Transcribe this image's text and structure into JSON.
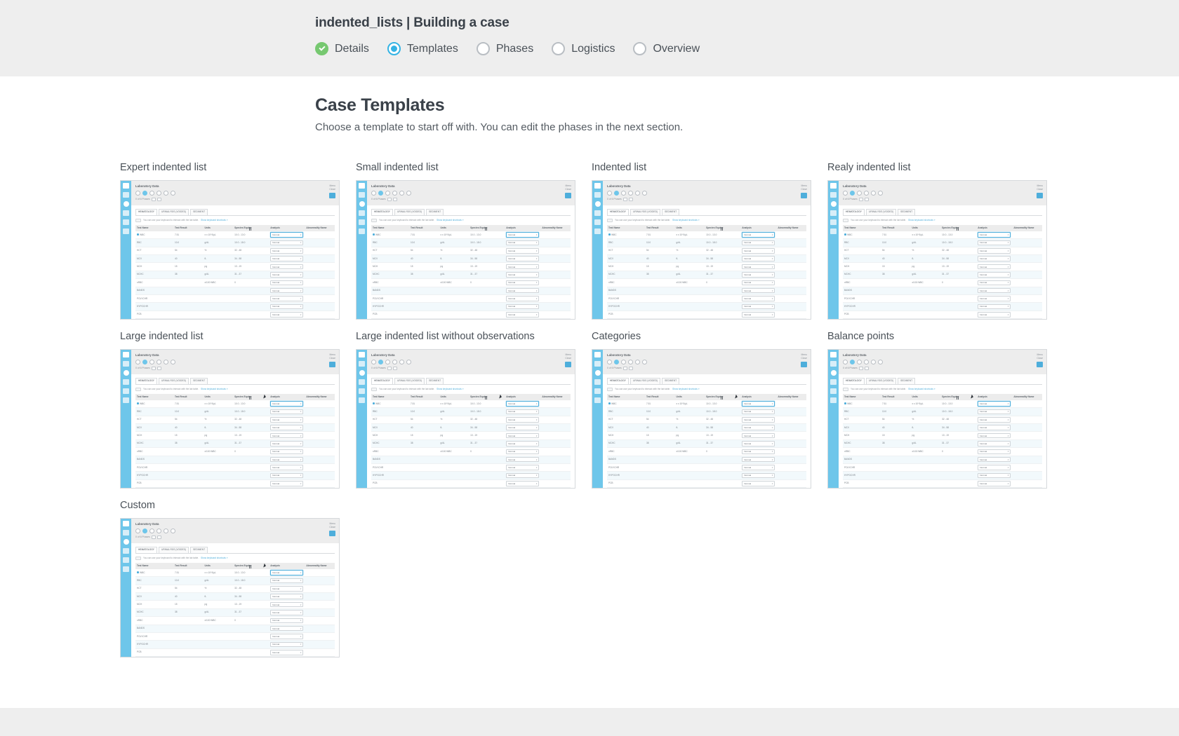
{
  "header": {
    "wizard_title": "indented_lists | Building a case",
    "steps": [
      {
        "label": "Details",
        "state": "done"
      },
      {
        "label": "Templates",
        "state": "active"
      },
      {
        "label": "Phases",
        "state": "todo"
      },
      {
        "label": "Logistics",
        "state": "todo"
      },
      {
        "label": "Overview",
        "state": "todo"
      }
    ]
  },
  "main": {
    "title": "Case Templates",
    "subtitle": "Choose a template to start off with. You can edit the phases in the next section."
  },
  "templates": [
    {
      "label": "Expert indented list"
    },
    {
      "label": "Small indented list"
    },
    {
      "label": "Indented list"
    },
    {
      "label": "Realy indented list"
    },
    {
      "label": "Large indented list"
    },
    {
      "label": "Large indented list without observations"
    },
    {
      "label": "Categories"
    },
    {
      "label": "Balance points"
    },
    {
      "label": "Custom"
    }
  ],
  "thumbnail": {
    "title": "Laboratory Data",
    "phase_label": "0 of 6 Phases",
    "close_label": "Close",
    "menu_label": "Menu",
    "tabs": [
      "HEMATOLOGY",
      "URINALYSIS (VOIDED)",
      "SEDIMENT"
    ],
    "note": "You can use your keyboard to interact with the lab table.",
    "note_link": "Show keyboard shortcuts »",
    "columns": [
      "Test Name",
      "Test Result",
      "Units",
      "Species Equine",
      "Analysis",
      "Abnormality Name"
    ],
    "rows": [
      {
        "name": "WBC",
        "result": "7.51",
        "units": "x x 10^3/µL",
        "range": "10.0 - 13.0",
        "analysis": "Normal"
      },
      {
        "name": "RBC",
        "result": "10.0",
        "units": "g/dL",
        "range": "10.0 - 18.0",
        "analysis": "Normal"
      },
      {
        "name": "HCT",
        "result": "54",
        "units": "%",
        "range": "32 - 48",
        "analysis": "Normal"
      },
      {
        "name": "MCV",
        "result": "40",
        "units": "fL",
        "range": "34 - 58",
        "analysis": "Normal"
      },
      {
        "name": "MCH",
        "result": "15",
        "units": "pg",
        "range": "13 - 19",
        "analysis": "Normal"
      },
      {
        "name": "MCHC",
        "result": "38",
        "units": "g/dL",
        "range": "31 - 37",
        "analysis": "Normal"
      },
      {
        "name": "nRBC",
        "result": "",
        "units": "x/100 WBC",
        "range": "0",
        "analysis": "Normal"
      },
      {
        "name": "BANDS",
        "result": "",
        "units": "",
        "range": "",
        "analysis": "Normal"
      },
      {
        "name": "POLYCHR",
        "result": "",
        "units": "",
        "range": "",
        "analysis": "Normal"
      },
      {
        "name": "HYPOCHR",
        "result": "",
        "units": "",
        "range": "",
        "analysis": "Normal"
      },
      {
        "name": "PCB",
        "result": "",
        "units": "",
        "range": "",
        "analysis": "Normal"
      }
    ]
  },
  "colors": {
    "accent": "#34b3e4",
    "done": "#76c870",
    "header_bg": "#eeeeee",
    "text": "#3a4149",
    "thumb_sidebar": "#6ec6ea"
  }
}
